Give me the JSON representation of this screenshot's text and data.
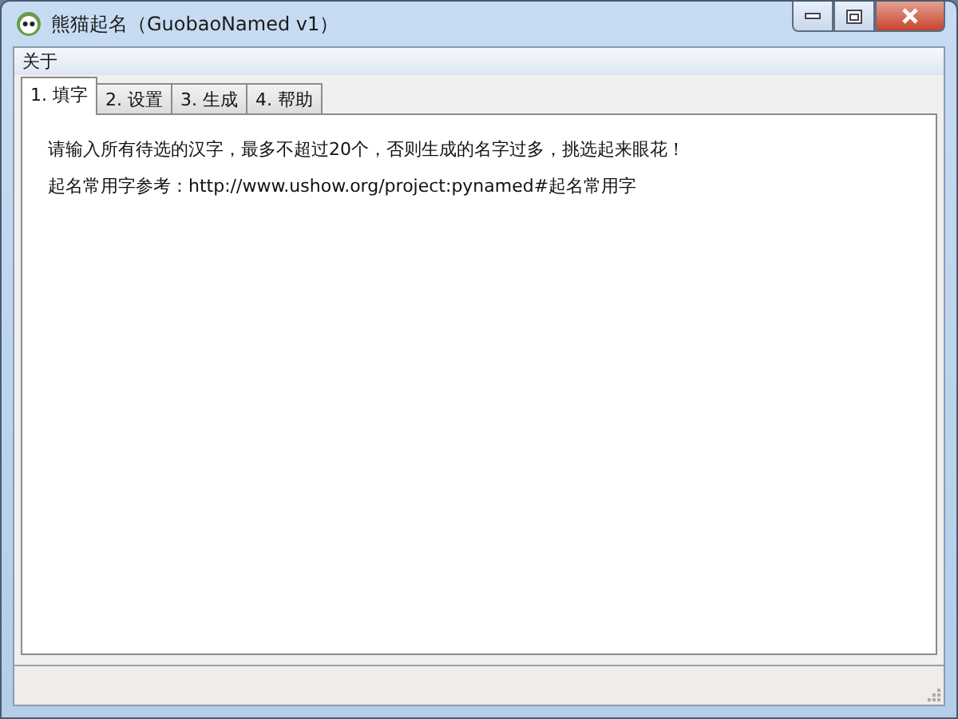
{
  "window": {
    "title": "熊猫起名（GuobaoNamed v1）"
  },
  "menu": [
    "关于"
  ],
  "tabs": [
    {
      "label": "1. 填字",
      "selected": true
    },
    {
      "label": "2. 设置",
      "selected": false
    },
    {
      "label": "3. 生成",
      "selected": false
    },
    {
      "label": "4. 帮助",
      "selected": false
    }
  ],
  "content": [
    "请输入所有待选的汉字，最多不超过20个，否则生成的名字过多，挑选起来眼花！",
    "起名常用字参考：http://www.ushow.org/project:pynamed#起名常用字"
  ]
}
